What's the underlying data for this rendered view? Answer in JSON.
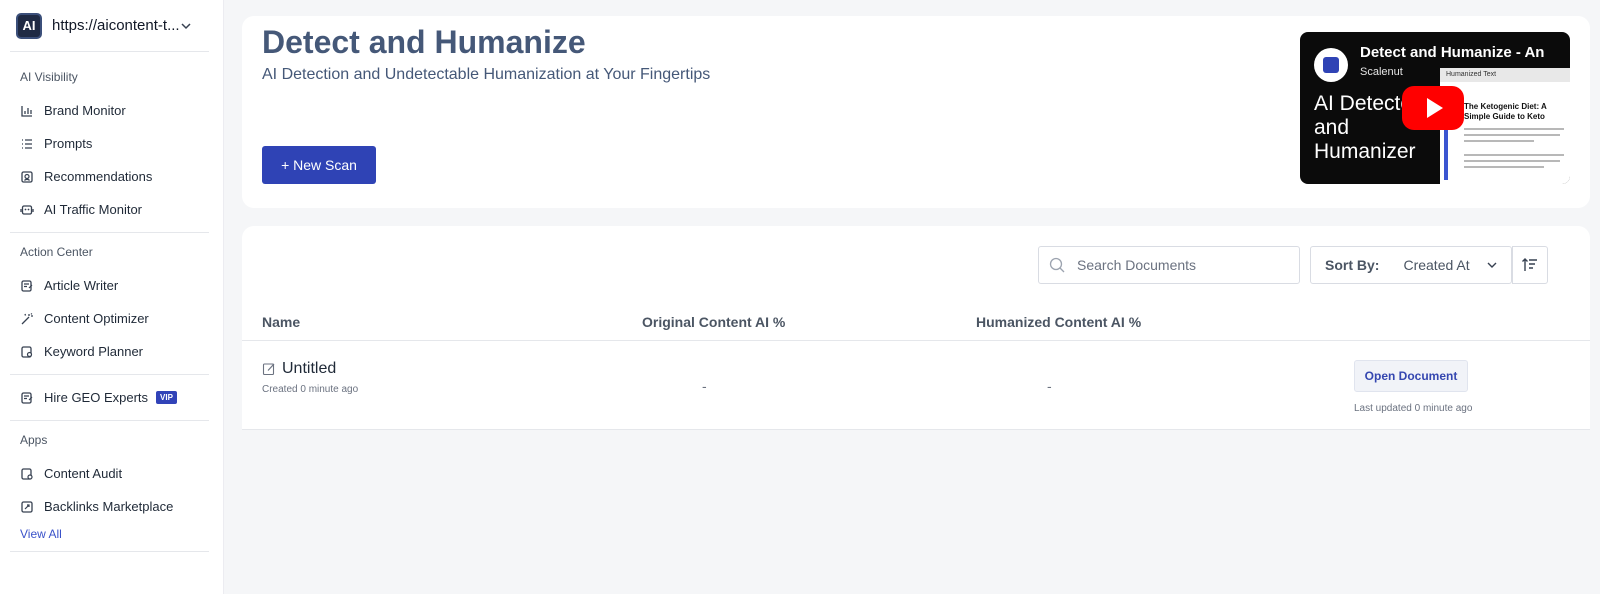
{
  "workspace": {
    "logo_text": "AI",
    "url": "https://aicontent-t..."
  },
  "sidebar": {
    "sections": [
      {
        "title": "AI Visibility",
        "items": [
          "Brand Monitor",
          "Prompts",
          "Recommendations",
          "AI Traffic Monitor"
        ]
      },
      {
        "title": "Action Center",
        "items": [
          "Article Writer",
          "Content Optimizer",
          "Keyword Planner"
        ]
      },
      {
        "title": "Apps",
        "items": [
          "Content Audit",
          "Backlinks Marketplace"
        ]
      }
    ],
    "hire": {
      "label": "Hire GEO Experts",
      "badge": "VIP"
    },
    "view_all": "View All"
  },
  "header": {
    "title": "Detect and Humanize",
    "subtitle": "AI Detection and Undetectable Humanization at Your Fingertips",
    "new_scan_label": "+ New Scan"
  },
  "video": {
    "title": "Detect and Humanize - An",
    "channel": "Scalenut",
    "overlay_text": "AI Detector and Humanizer",
    "doc_header": "Humanized Text",
    "doc_title": "The Ketogenic Diet: A Simple Guide to Keto"
  },
  "documents": {
    "search_placeholder": "Search Documents",
    "sort_label": "Sort By:",
    "sort_value": "Created At",
    "columns": [
      "Name",
      "Original Content AI %",
      "Humanized Content AI %"
    ],
    "rows": [
      {
        "name": "Untitled",
        "created": "Created 0 minute ago",
        "original": "-",
        "humanized": "-",
        "action": "Open Document",
        "updated": "Last updated 0 minute ago"
      }
    ]
  },
  "colors": {
    "accent": "#2f43b5",
    "title": "#455878"
  }
}
